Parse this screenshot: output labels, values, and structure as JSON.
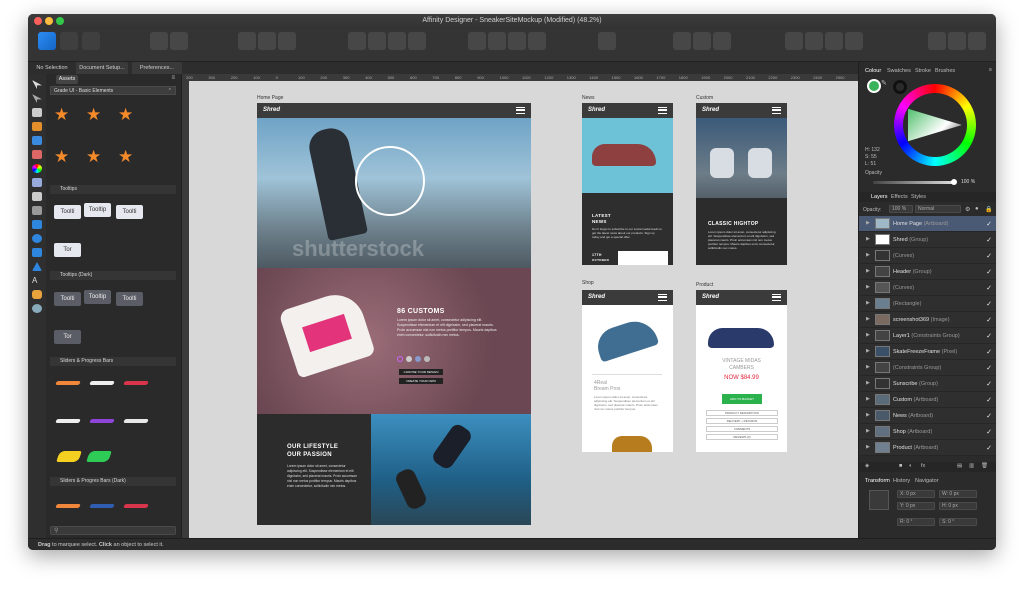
{
  "window": {
    "title": "Affinity Designer - SneakerSiteMockup (Modified) (48.2%)"
  },
  "tabs": {
    "no_selection": "No Selection",
    "document_setup": "Document Setup...",
    "preferences": "Preferences..."
  },
  "assets": {
    "tab": "Assets",
    "category": "Grade UI - Basic Elements",
    "sections": [
      "Tooltips",
      "Tooltips (Dark)",
      "Sliders & Progress Bars",
      "Sliders & Progres Bars (Dark)"
    ],
    "tooltip_labels": [
      "Toolti",
      "Tooltip",
      "Toolti",
      "Tor"
    ],
    "tooltip_dark_labels": [
      "Toolti",
      "Tooltip",
      "Toolti",
      "Tor"
    ]
  },
  "ruler": {
    "ticks": [
      "200",
      "300",
      "200",
      "100",
      "0",
      "100",
      "200",
      "300",
      "400",
      "500",
      "600",
      "700",
      "800",
      "900",
      "1000",
      "1100",
      "1200",
      "1300",
      "1400",
      "1500",
      "1600",
      "1700",
      "1800",
      "1900",
      "2000",
      "2100",
      "2200",
      "2300",
      "2400",
      "2500",
      "2600"
    ]
  },
  "artboards": {
    "home": {
      "label": "Home Page",
      "logo": "Shred",
      "watermark": "shutterstock",
      "customs_title": "86 CUSTOMS",
      "customs_body": "Lorem ipsum dolor sit amet, consectetur adipiscing elit. Suspendisse elementum et elit dignissim, sed placerat mauris. Proin accumsan nisl non metus porttitor tempus. Mauris dapibus enim consectetur, sollicitudin nec metus.",
      "btn_choose": "CHOOSE YOUR DESIGN",
      "btn_create": "CREATE YOUR OWN",
      "lifestyle_title1": "OUR LIFESTYLE",
      "lifestyle_title2": "OUR PASSION",
      "lifestyle_body": "Lorem ipsum dolor sit amet, consectetur adipiscing elit. Suspendisse elementum et elit dignissim, sed placerat mauris. Proin accumsan nisl non metus porttitor tempus. Mauris dapibus enim consectetur, sollicitudin nec metus."
    },
    "news": {
      "label": "News",
      "logo": "Shred",
      "title1": "LATEST",
      "title2": "NEWS",
      "body": "Don't forget to subscribe to our social media feeds to get the latest news about our products. Sign up today and get a special offer.",
      "date1": "17TH",
      "date2": "OCTOBER"
    },
    "custom": {
      "label": "Custom",
      "logo": "Shred",
      "title": "CLASSIC HIGHTOP",
      "body": "Lorem ipsum dolor sit amet, consectetur adipiscing elit. Suspendisse elementum et elit dignissim, sed placerat mauris. Proin accumsan nisl non metus porttitor tempus. Mauris dapibus enim consectetur, sollicitudin nec metus."
    },
    "shop": {
      "label": "Shop",
      "logo": "Shred",
      "name1": "4Real",
      "name2": "Bream Pros",
      "body": "Lorem ipsum dolor sit amet, consectetur adipiscing elit. Suspendisse elementum et elit dignissim, sed placerat mauris. Proin accumsan nisl non metus porttitor tempus."
    },
    "product": {
      "label": "Product",
      "logo": "Shred",
      "name1": "VINTAGE MIDAS",
      "name2": "CAMBERS",
      "price": "NOW $84.99",
      "btn": "ADD TO BASKET",
      "rows": [
        "PRODUCT DESCRIPTION",
        "DELIVERY + RETURNS",
        "COMMENTS",
        "REVIEWS (0)"
      ]
    }
  },
  "color_panel": {
    "tabs": [
      "Colour",
      "Swatches",
      "Stroke",
      "Brushes"
    ],
    "h": "H: 132",
    "s": "S: 55",
    "l": "L: 51",
    "opacity_label": "Opacity",
    "opacity_value": "100 %"
  },
  "layers_panel": {
    "tabs": [
      "Layers",
      "Effects",
      "Styles"
    ],
    "opacity_label": "Opacity:",
    "opacity_value": "100 %",
    "blend": "Normal",
    "rows": [
      {
        "name": "Home Page",
        "type": "(Artboard)",
        "selected": true
      },
      {
        "name": "Shred",
        "type": "(Group)"
      },
      {
        "name": "",
        "type": "(Curves)"
      },
      {
        "name": "Header",
        "type": "(Group)"
      },
      {
        "name": "",
        "type": "(Curves)"
      },
      {
        "name": "",
        "type": "(Rectangle)"
      },
      {
        "name": "screenshot369",
        "type": "(Image)"
      },
      {
        "name": "Layer1",
        "type": "(Constraints Group)"
      },
      {
        "name": "SkateFreezeFrame",
        "type": "(Pixel)"
      },
      {
        "name": "",
        "type": "(Constraints Group)"
      },
      {
        "name": "Sunscribe",
        "type": "(Group)"
      },
      {
        "name": "Custom",
        "type": "(Artboard)"
      },
      {
        "name": "News",
        "type": "(Artboard)"
      },
      {
        "name": "Shop",
        "type": "(Artboard)"
      },
      {
        "name": "Product",
        "type": "(Artboard)"
      }
    ]
  },
  "transform_panel": {
    "tabs": [
      "Transform",
      "History",
      "Navigator"
    ],
    "x": "X: 0 px",
    "y": "Y: 0 px",
    "w": "W: 0 px",
    "h": "H: 0 px",
    "r": "R: 0 °",
    "s": "S: 0 °"
  },
  "status": {
    "bold1": "Drag",
    "text1": " to marquee select. ",
    "bold2": "Click",
    "text2": " an object to select it."
  }
}
